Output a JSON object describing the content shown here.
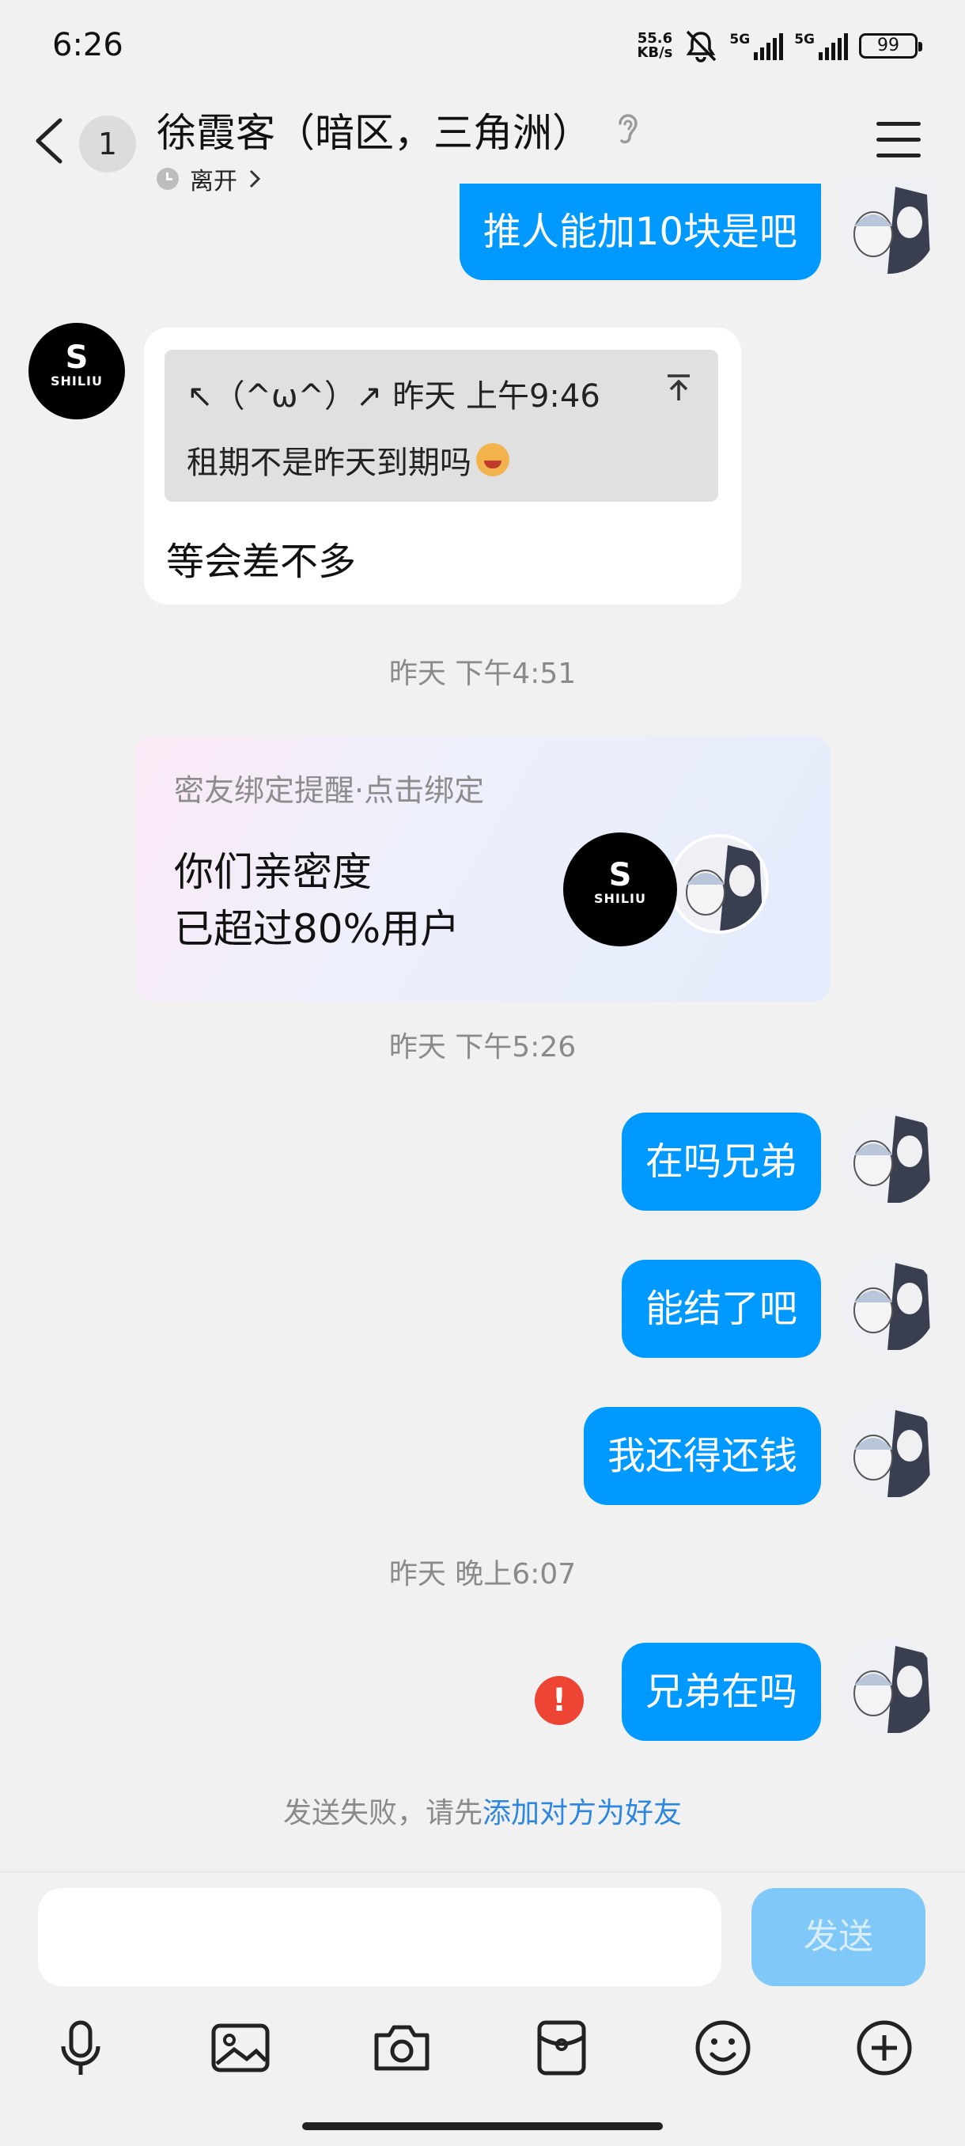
{
  "status_bar": {
    "time": "6:26",
    "net_speed_value": "55.6",
    "net_speed_unit": "KB/s",
    "sim1": "5G",
    "sim2": "5G",
    "battery": "99"
  },
  "header": {
    "unread_count": "1",
    "title": "徐霞客（暗区，三角洲）",
    "presence": "离开"
  },
  "messages": {
    "m1": "推人能加10块是吧",
    "reply_quote_header": "↖（^ω^）↗ 昨天 上午9:46",
    "reply_quote_body": "租期不是昨天到期吗",
    "reply_text": "等会差不多",
    "ts1": "昨天 下午4:51",
    "card_title": "密友绑定提醒·点击绑定",
    "card_line1": "你们亲密度",
    "card_line2": "已超过80%用户",
    "ts2": "昨天 下午5:26",
    "m2": "在吗兄弟",
    "m3": "能结了吧",
    "m4": "我还得还钱",
    "ts3": "昨天 晚上6:07",
    "m5": "兄弟在吗",
    "fail_prefix": "发送失败，请先",
    "fail_link": "添加对方为好友"
  },
  "composer": {
    "send_label": "发送",
    "input_value": ""
  },
  "avatar_logo": {
    "mark": "S",
    "name": "SHILIU"
  },
  "toolbar_icons": [
    "mic-icon",
    "image-icon",
    "camera-icon",
    "red-packet-icon",
    "emoji-icon",
    "plus-icon"
  ],
  "colors": {
    "accent": "#0099ff",
    "send_disabled": "#80c8f8",
    "error": "#ee4433",
    "link": "#2d86e0"
  }
}
